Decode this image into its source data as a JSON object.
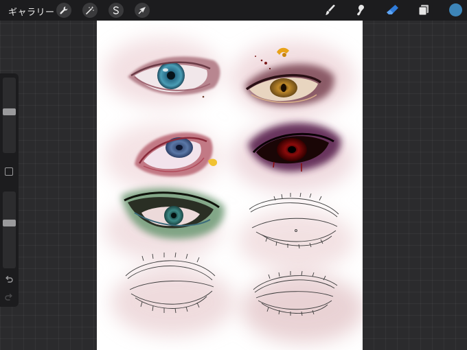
{
  "app": {
    "gallery_label": "ギャラリー"
  },
  "toolbar": {
    "left_tools": [
      {
        "icon": "wrench-icon",
        "name": "actions"
      },
      {
        "icon": "magic-wand-icon",
        "name": "adjustments"
      },
      {
        "icon": "selection-s-icon",
        "name": "selection"
      },
      {
        "icon": "arrow-cursor-icon",
        "name": "transform"
      }
    ],
    "right_tools": [
      {
        "icon": "brush-icon",
        "name": "paint"
      },
      {
        "icon": "smudge-icon",
        "name": "smudge"
      },
      {
        "icon": "eraser-icon",
        "name": "erase",
        "active": true
      },
      {
        "icon": "layers-icon",
        "name": "layers"
      }
    ],
    "current_color": "#3d85b8"
  },
  "sidebar": {
    "brush_size_level": 0.55,
    "opacity_level": 0.6
  },
  "colors": {
    "background": "#2b2b2d",
    "toolbar": "#1c1c1e",
    "active_tool": "#2f7bd9",
    "canvas": "#ffffff"
  }
}
